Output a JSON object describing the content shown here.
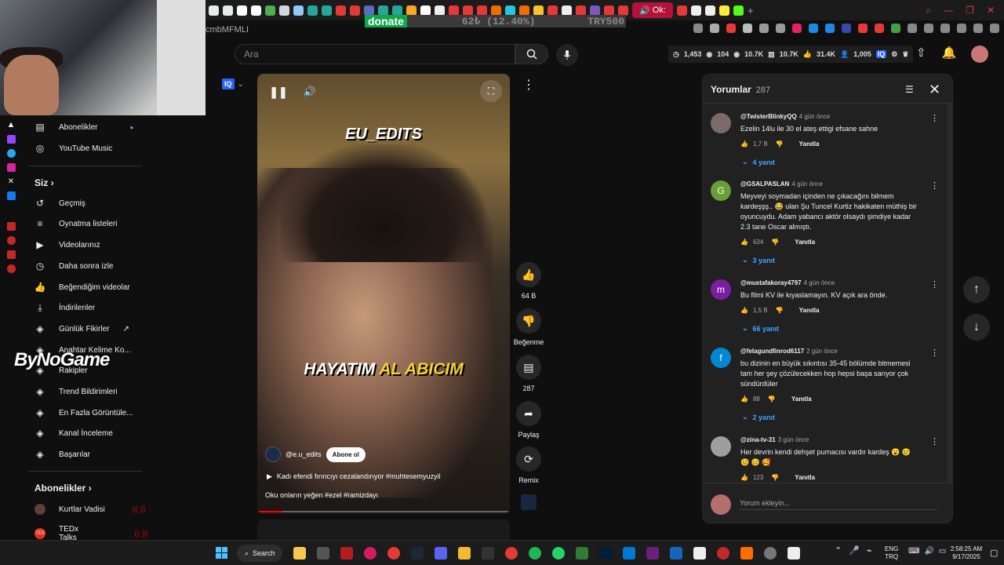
{
  "browser": {
    "active_tab_label": "Ok:",
    "url_fragment": "cmbMFMLI",
    "donate": {
      "label": "donate",
      "amount": "62₺ (12.40%)",
      "goal": "TRY500",
      "progress_percent": 12.4
    }
  },
  "header": {
    "search_placeholder": "Ara",
    "stats": [
      "1,453",
      "104",
      "10.7K",
      "10.7K",
      "31.4K",
      "1,005"
    ]
  },
  "sidebar": {
    "top_items": [
      "Abonelikler",
      "YouTube Music"
    ],
    "you_heading": "Siz",
    "you_items": [
      "Geçmiş",
      "Oynatma listeleri",
      "Videolarınız",
      "Daha sonra izle",
      "Beğendiğim videolar",
      "İndirilenler"
    ],
    "ext_items": [
      "Günlük Fikirler",
      "Anahtar Kelime Ko...",
      "Rakipler",
      "Trend Bildirimleri",
      "En Fazla Görüntüle...",
      "Kanal İnceleme",
      "Başarılar"
    ],
    "subs_heading": "Abonelikler",
    "subs": [
      "Kurtlar Vadisi",
      "TEDx Talks"
    ],
    "overlay_logo": "ByNoGame"
  },
  "player": {
    "watermark": "EU_EDITS",
    "caption_white": "HAYATIM",
    "caption_yellow": "AL ABICIM",
    "channel": "@e.u_edits",
    "subscribe_label": "Abone ol",
    "music": "Kadı efendi fırıncıyı cezalandırıyor #muhtesemyuzyil",
    "description": "Oku onların yeğen #ezel #ramizdayı",
    "progress_fraction": 0.1
  },
  "actions": {
    "like_count": "64 B",
    "dislike_label": "Beğenme",
    "comment_count": "287",
    "share_label": "Paylaş",
    "remix_label": "Remix"
  },
  "comments": {
    "title": "Yorumlar",
    "count": "287",
    "add_placeholder": "Yorum ekleyin...",
    "reply_label": "Yanıtla",
    "items": [
      {
        "author": "@TwisterBlinkyQQ",
        "time": "4 gün önce",
        "text": "Ezelin 14lu ile 30 el ateş ettigi efsane sahne",
        "likes": "1,7 B",
        "replies": "4 yanıt",
        "avatar_letter": "",
        "avatar_color": "#7a6a6a"
      },
      {
        "author": "@GSALPASLAN",
        "time": "4 gün önce",
        "text": "Meyveyi soymadan içinden ne çıkacağını bilmem kardeşşş.. 😂 ulan Şu Tuncel Kurtiz hakikaten müthiş bir oyuncuydu. Adam yabancı aktör olsaydı şimdiye kadar 2.3 tane Oscar almıştı.",
        "likes": "634",
        "replies": "3 yanıt",
        "avatar_letter": "G",
        "avatar_color": "#689f38"
      },
      {
        "author": "@mustafakoray4797",
        "time": "4 gün önce",
        "text": "Bu filmi KV ile kıyaslamayın. KV açık ara önde.",
        "likes": "1,5 B",
        "replies": "66 yanıt",
        "avatar_letter": "m",
        "avatar_color": "#7b1fa2"
      },
      {
        "author": "@felagundfinrod6117",
        "time": "2 gün önce",
        "text": "bu dizinin en büyük sıkıntısı 35-45 bölümde bitmemesi tam her şey çözülecekken hop hepsi başa sarıyor çok sündürdüler",
        "likes": "88",
        "replies": "2 yanıt",
        "avatar_letter": "f",
        "avatar_color": "#0288d1"
      },
      {
        "author": "@zina-tv-31",
        "time": "3 gün önce",
        "text": "Her devrin kendi dehşet purnacısı vardır kardeş 😮 😢 😊 😊 🥰",
        "likes": "123",
        "replies": "",
        "avatar_letter": "",
        "avatar_color": "#9e9e9e"
      }
    ]
  },
  "taskbar": {
    "search_label": "Search",
    "lang_line1": "ENG",
    "lang_line2": "TRQ",
    "time": "2:58:25 AM",
    "date": "9/17/2025"
  }
}
